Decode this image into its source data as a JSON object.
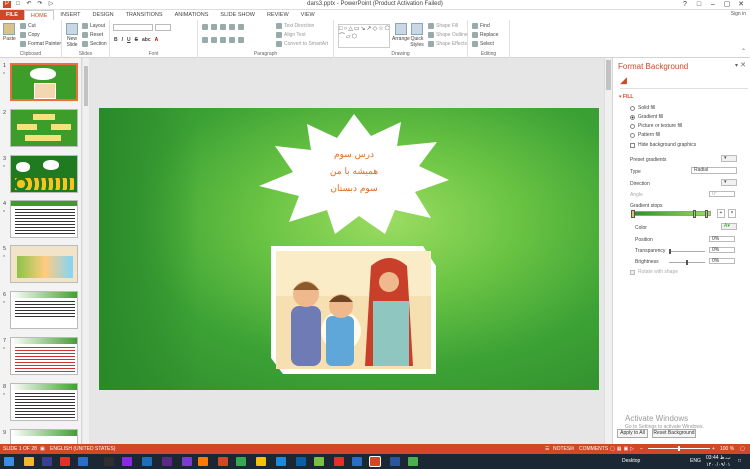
{
  "window": {
    "title": "dars3.pptx - PowerPoint (Product Activation Failed)",
    "signin": "Sign in"
  },
  "ribbon_tabs": [
    "FILE",
    "HOME",
    "INSERT",
    "DESIGN",
    "TRANSITIONS",
    "ANIMATIONS",
    "SLIDE SHOW",
    "REVIEW",
    "VIEW"
  ],
  "ribbon": {
    "clipboard": {
      "paste": "Paste",
      "cut": "Cut",
      "copy": "Copy",
      "format_painter": "Format Painter",
      "name": "Clipboard"
    },
    "slides": {
      "new_slide": "New Slide",
      "layout": "Layout",
      "reset": "Reset",
      "section": "Section",
      "name": "Slides"
    },
    "font": {
      "name": "Font"
    },
    "paragraph": {
      "text_direction": "Text Direction",
      "align_text": "Align Text",
      "convert": "Convert to SmartArt",
      "name": "Paragraph"
    },
    "drawing": {
      "arrange": "Arrange",
      "quick_styles": "Quick Styles",
      "shape_fill": "Shape Fill",
      "shape_outline": "Shape Outline",
      "shape_effects": "Shape Effects",
      "name": "Drawing"
    },
    "editing": {
      "find": "Find",
      "replace": "Replace",
      "select": "Select",
      "name": "Editing"
    }
  },
  "thumbnails": [
    "1",
    "2",
    "3",
    "4",
    "5",
    "6",
    "7",
    "8",
    "9"
  ],
  "slide": {
    "line1": "درس سوم",
    "line2": "همیشه با من",
    "line3": "سوم دبستان"
  },
  "format_pane": {
    "title": "Format Background",
    "section": "FILL",
    "solid_fill": "Solid fill",
    "gradient_fill": "Gradient fill",
    "picture_fill": "Picture or texture fill",
    "pattern_fill": "Pattern fill",
    "hide_graphics": "Hide background graphics",
    "preset_gradients": "Preset gradients",
    "type_label": "Type",
    "type_value": "Radial",
    "direction": "Direction",
    "angle": "Angle",
    "angle_value": "0°",
    "gradient_stops": "Gradient stops",
    "color": "Color",
    "position": "Position",
    "position_value": "0%",
    "transparency": "Transparency",
    "transparency_value": "0%",
    "brightness": "Brightness",
    "brightness_value": "0%",
    "rotate": "Rotate with shape",
    "apply_all": "Apply to All",
    "reset_bg": "Reset Background",
    "activate_title": "Activate Windows",
    "activate_sub": "Go to Settings to activate Windows."
  },
  "status": {
    "slide_info": "SLIDE 1 OF 28",
    "language": "ENGLISH (UNITED STATES)",
    "notes": "NOTES",
    "comments": "COMMENTS",
    "zoom": "100 %"
  },
  "taskbar": {
    "desktop": "Desktop",
    "lang": "ENG",
    "time": "03:44 ب.ظ",
    "date": "۱۴۰۰/۰۹/۰۱"
  },
  "colors": {
    "accent": "#d24726",
    "slide_green": "#3ca235",
    "text_orange": "#e26a1a"
  }
}
